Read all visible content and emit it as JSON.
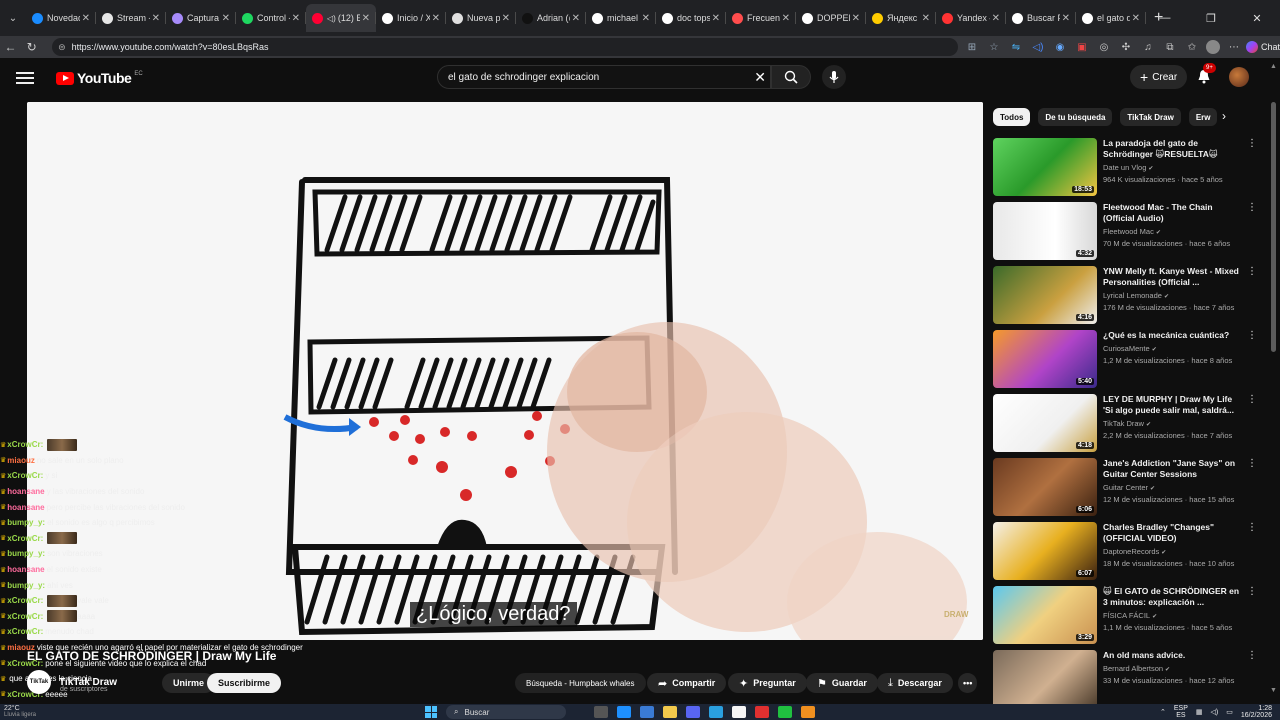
{
  "browser": {
    "tabs": [
      {
        "label": "Novedad",
        "color": "#1a8cff"
      },
      {
        "label": "Stream - I",
        "color": "#e6e6e6"
      },
      {
        "label": "Captura d",
        "color": "#a78bfa"
      },
      {
        "label": "Control -",
        "color": "#1ed760"
      },
      {
        "label": "(12) E",
        "color": "#ff0033",
        "active": true
      },
      {
        "label": "Inicio / X",
        "color": "#ffffff"
      },
      {
        "label": "Nueva pe",
        "color": "#e0e0e0"
      },
      {
        "label": "Adrian (@",
        "color": "#111111"
      },
      {
        "label": "michael m",
        "color": "#ffffff"
      },
      {
        "label": "doc tops",
        "color": "#ffffff"
      },
      {
        "label": "Frecuenc",
        "color": "#ff4d4d"
      },
      {
        "label": "DOPPELG",
        "color": "#ffffff"
      },
      {
        "label": "Яндекс К",
        "color": "#ffcc00"
      },
      {
        "label": "Yandex —",
        "color": "#ff3333"
      },
      {
        "label": "Buscar Po",
        "color": "#ffffff"
      },
      {
        "label": "el gato d",
        "color": "#ffffff"
      }
    ],
    "url": "https://www.youtube.com/watch?v=80esLBqsRas",
    "chat_label": "Chat"
  },
  "youtube": {
    "logo_text": "YouTube",
    "country": "EC",
    "search_value": "el gato de schrodinger explicacion",
    "create_label": "Crear",
    "notif_badge": "9+"
  },
  "video": {
    "subtitle": "¿Lógico, verdad?",
    "watermark": "DRAW",
    "title": "EL GATO DE SCHRÖDINGER | Draw My Life",
    "channel": "TikTak Draw",
    "channel_avatar_text": "TikTak",
    "subs": "de suscriptores",
    "join_label": "Unirme",
    "subscribe_label": "Suscribirme",
    "now_playing": "Búsqueda - Humpback whales",
    "share_label": "Compartir",
    "ask_label": "Preguntar",
    "save_label": "Guardar",
    "download_label": "Descargar"
  },
  "chat": [
    {
      "user": "xCrowCr:",
      "msg": "",
      "color": "#9ad94a",
      "emote": true
    },
    {
      "user": "miaouz",
      "msg": "no sale en un solo plano",
      "color": "#ff7043"
    },
    {
      "user": "xCrowCr:",
      "msg": "y si",
      "color": "#9ad94a"
    },
    {
      "user": "hoansane",
      "msg": "y las vibraciones del sonido",
      "color": "#ff6b9d"
    },
    {
      "user": "hoansane",
      "msg": "pero percibe las vibraciones del sonido",
      "color": "#ff6b9d"
    },
    {
      "user": "bumpy_y:",
      "msg": "el sonido es algo q percibimos",
      "color": "#9ad94a"
    },
    {
      "user": "xCrowCr:",
      "msg": "",
      "color": "#9ad94a",
      "emote": true
    },
    {
      "user": "bumpy_y:",
      "msg": "son vibraciones",
      "color": "#9ad94a"
    },
    {
      "user": "hoansane",
      "msg": "el sonido existe",
      "color": "#ff6b9d"
    },
    {
      "user": "bumpy_y:",
      "msg": "ahí ves",
      "color": "#9ad94a"
    },
    {
      "user": "xCrowCr:",
      "msg": "vale vale",
      "color": "#9ad94a",
      "emote": true
    },
    {
      "user": "xCrowCr:",
      "msg": "aaaa",
      "color": "#9ad94a",
      "emote": true
    },
    {
      "user": "xCrowCr:",
      "msg": "menudo chad",
      "color": "#9ad94a"
    },
    {
      "user": "miaouz",
      "msg": "viste que recién uno agarró el papel por materializar el gato de schrodinger",
      "color": "#ff7043",
      "bright": true
    },
    {
      "user": "xCrowCr:",
      "msg": "pone el siguiente video que lo explica el chad",
      "color": "#9ad94a",
      "bright": true
    },
    {
      "user": "",
      "msg": "que aplica es la ciencia",
      "color": "#9ad94a",
      "bright": true
    },
    {
      "user": "xCrowCr:",
      "msg": "eeeee",
      "color": "#9ad94a",
      "bright": true
    },
    {
      "user": "miaouz",
      "msg": "si por eso existen los bits cuanticos",
      "color": "#ff7043",
      "bright": true
    }
  ],
  "sidebar": {
    "chips": [
      "Todos",
      "De tu búsqueda",
      "TikTak Draw",
      "Erw"
    ],
    "items": [
      {
        "title": "La paradoja del gato de Schrödinger 🙀RESUELTA🙀",
        "channel": "Date un Vlog",
        "meta": "964 K visualizaciones · hace 5 años",
        "duration": "18:53",
        "thumb": "linear-gradient(135deg,#5fd35f,#2a9a2a 50%,#f4c542)"
      },
      {
        "title": "Fleetwood Mac - The Chain (Official Audio)",
        "channel": "Fleetwood Mac",
        "meta": "70 M de visualizaciones · hace 6 años",
        "duration": "4:32",
        "thumb": "linear-gradient(90deg,#e8e8e8,#ffffff 60%,#d8d8d8)"
      },
      {
        "title": "YNW Melly ft. Kanye West - Mixed Personalities (Official ...",
        "channel": "Lyrical Lemonade",
        "meta": "176 M de visualizaciones · hace 7 años",
        "duration": "4:16",
        "thumb": "linear-gradient(135deg,#3a6a2a,#caa040 60%,#eee)"
      },
      {
        "title": "¿Qué es la mecánica cuántica?",
        "channel": "CuriosaMente",
        "meta": "1,2 M de visualizaciones · hace 8 años",
        "duration": "5:40",
        "thumb": "linear-gradient(135deg,#f59a2a,#b044c8 55%,#3a2a8a)"
      },
      {
        "title": "LEY DE MURPHY | Draw My Life 'Si algo puede salir mal, saldrá...",
        "channel": "TikTak Draw",
        "meta": "2,2 M de visualizaciones · hace 7 años",
        "duration": "4:18",
        "thumb": "linear-gradient(135deg,#ffffff,#f0f0f0 60%,#c8a040)"
      },
      {
        "title": "Jane's Addiction \"Jane Says\" on Guitar Center Sessions",
        "channel": "Guitar Center",
        "meta": "12 M de visualizaciones · hace 15 años",
        "duration": "6:06",
        "thumb": "linear-gradient(135deg,#6a3a20,#b07040 50%,#3a2010)"
      },
      {
        "title": "Charles Bradley \"Changes\" (OFFICIAL VIDEO)",
        "channel": "DaptoneRecords",
        "meta": "18 M de visualizaciones · hace 10 años",
        "duration": "6:07",
        "thumb": "linear-gradient(135deg,#f4f0e8,#e8b020 50%,#3a2010)"
      },
      {
        "title": "🙀 El GATO de SCHRÖDINGER en 3 minutos: explicación ...",
        "channel": "FÍSICA FÁCIL",
        "meta": "1,1 M de visualizaciones · hace 5 años",
        "duration": "3:29",
        "thumb": "linear-gradient(135deg,#5ac8f0,#f0d080 50%,#c89050)"
      },
      {
        "title": "An old mans advice.",
        "channel": "Bernard Albertson",
        "meta": "33 M de visualizaciones · hace 12 años",
        "duration": "",
        "thumb": "linear-gradient(135deg,#7a6a5a,#d0b090 55%,#4a3a2a)"
      }
    ]
  },
  "taskbar": {
    "widget_title": "22°C",
    "widget_sub": "Lluvia ligera",
    "search_label": "Buscar",
    "lang_top": "ESP",
    "lang_bottom": "ES",
    "time": "1:28",
    "date": "16/2/2026"
  }
}
